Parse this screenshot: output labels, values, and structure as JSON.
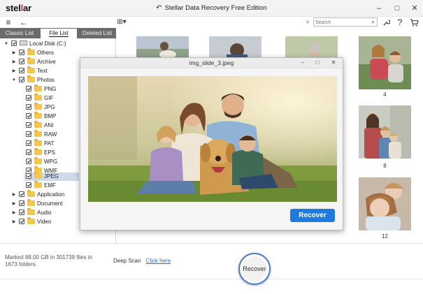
{
  "app": {
    "logo_prefix": "stel",
    "logo_star": "l",
    "logo_suffix": "ar",
    "title": "Stellar Data Recovery Free Edition",
    "title_icon": "undo-arrow-icon"
  },
  "window_controls": [
    "–",
    "□",
    "✕"
  ],
  "toolbar": {
    "menu_icon": "≡",
    "back_icon": "←",
    "view_icon": "⊞▾",
    "expand_icon": "»",
    "search_placeholder": "Search",
    "search_icon": "⌕",
    "settings_icon": "wrench-icon",
    "help_icon": "?",
    "cart_icon": "cart-icon"
  },
  "tabs": [
    "Classic List",
    "File List",
    "Deleted List"
  ],
  "active_tab": "File List",
  "tree": {
    "root": "Local Disk (C:)",
    "folders": [
      {
        "label": "Others",
        "expanded": false
      },
      {
        "label": "Archive",
        "expanded": false
      },
      {
        "label": "Text",
        "expanded": false
      },
      {
        "label": "Photos",
        "expanded": true
      }
    ],
    "photo_types": [
      "PNG",
      "GIF",
      "JPG",
      "BMP",
      "ANI",
      "RAW",
      "PAT",
      "EPS",
      "WPG",
      "WMF",
      "JPEG",
      "EMF"
    ],
    "selected": "JPEG",
    "more_folders": [
      "Application",
      "Document",
      "Audio",
      "Video"
    ]
  },
  "grid": {
    "captions": [
      "4",
      "8",
      "12"
    ]
  },
  "modal": {
    "title": "img_slide_3.jpeg",
    "controls": [
      "–",
      "□",
      "✕"
    ],
    "recover_label": "Recover"
  },
  "status": {
    "marked": "Marked 88.00 GB in 301739 files in 1673 folders",
    "deep_scan_label": "Deep Scan",
    "deep_scan_link": "Click here",
    "recover_label": "Recover"
  },
  "colors": {
    "accent": "#1f7ae0",
    "tab_bar": "#6b6b6b",
    "selected_row": "#cfd9e8",
    "folder": "#f4c64b"
  }
}
